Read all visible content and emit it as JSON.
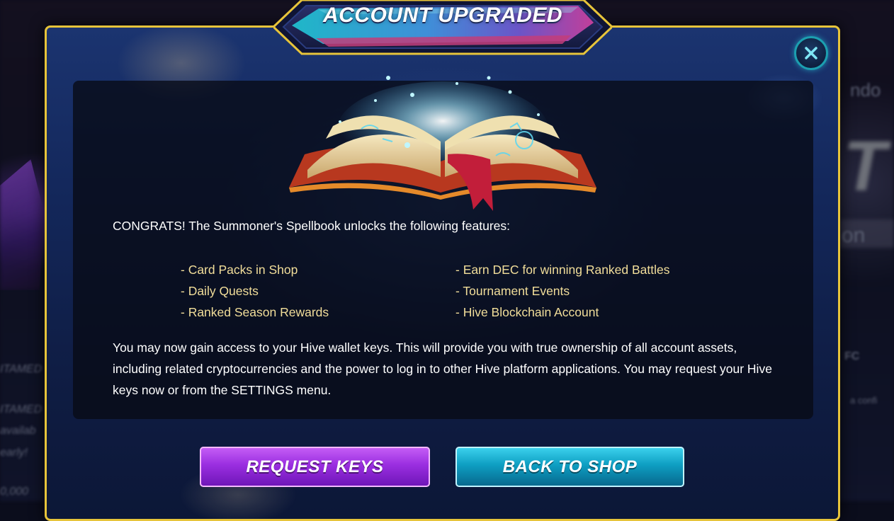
{
  "background": {
    "texts": [
      "ITAMED",
      "ITAMED",
      "availab",
      "early!",
      "0,000",
      "on",
      "FC",
      "a confi",
      "ndo"
    ],
    "big_text": "T"
  },
  "dialog": {
    "title": "ACCOUNT UPGRADED",
    "congrats": "CONGRATS! The Summoner's Spellbook unlocks the following features:",
    "features_left": [
      "- Card Packs in Shop",
      "- Daily Quests",
      "- Ranked Season Rewards"
    ],
    "features_right": [
      "- Earn DEC for winning Ranked Battles",
      "- Tournament Events",
      "- Hive Blockchain Account"
    ],
    "info": "You may now gain access to your Hive wallet keys. This will provide you with true ownership of all account assets, including related cryptocurrencies and the power to log in to other Hive platform applications. You may request your Hive keys now or from the SETTINGS menu.",
    "buttons": {
      "request_keys": "REQUEST KEYS",
      "back_to_shop": "BACK TO SHOP"
    },
    "close_icon": "close-icon",
    "image": "spellbook-icon"
  },
  "colors": {
    "border": "#e7c43a",
    "feature_text": "#f2de9a",
    "request_button": "#9a2ee0",
    "shop_button": "#0e9ec2",
    "close_ring": "#1c9fb0"
  }
}
